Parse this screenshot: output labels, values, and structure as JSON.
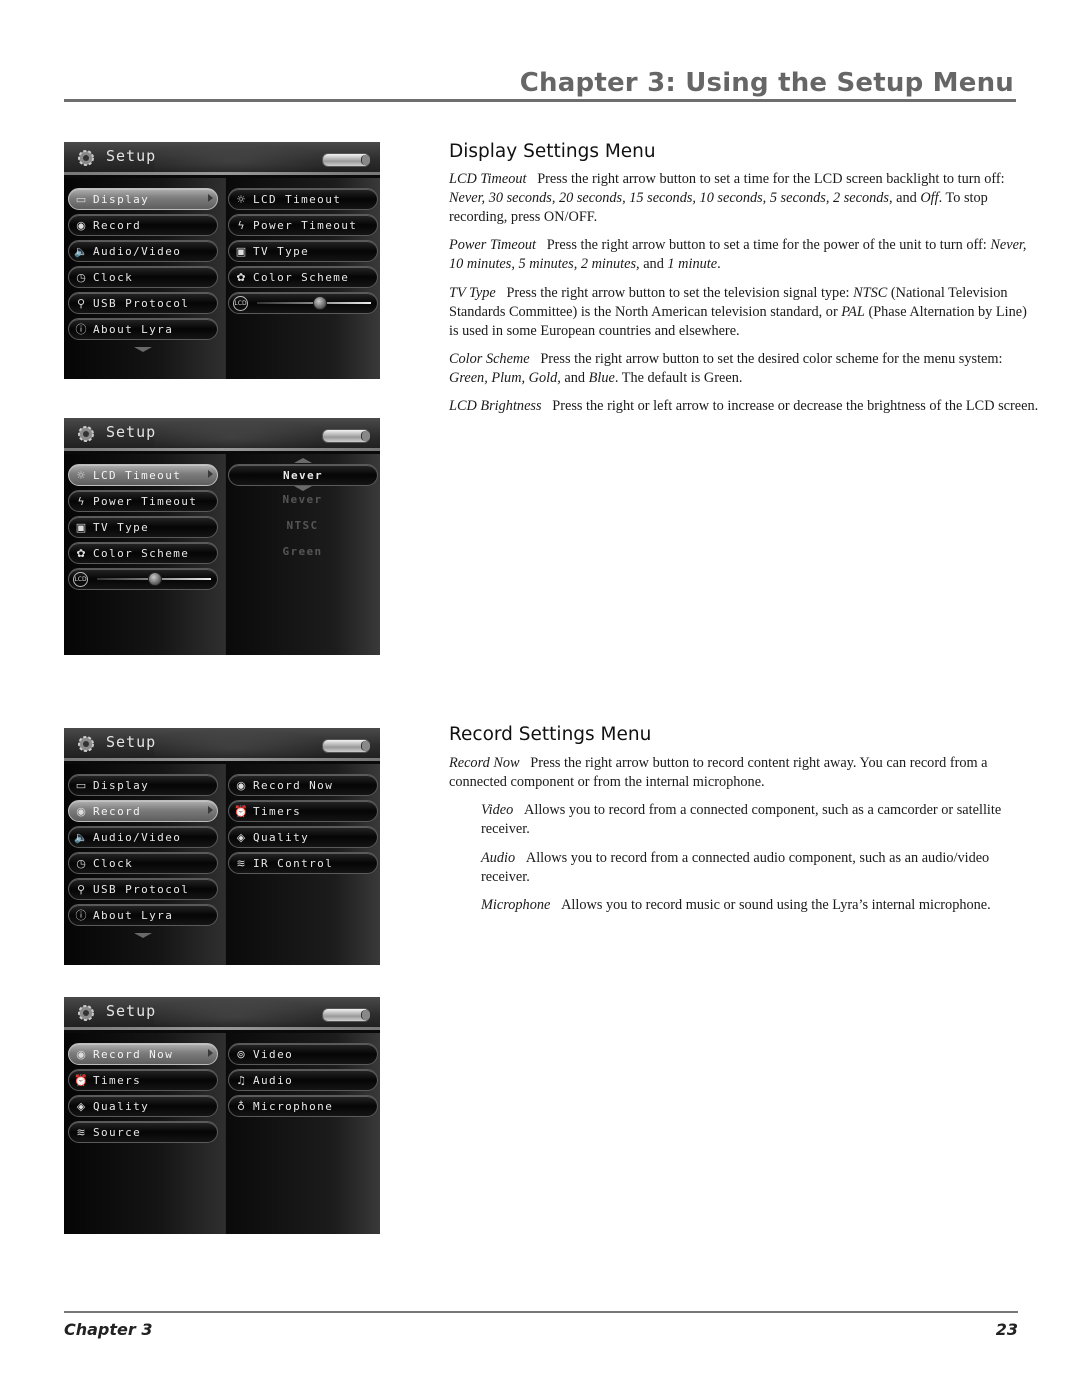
{
  "header": {
    "chapter_title": "Chapter 3: Using the Setup Menu"
  },
  "screens": [
    {
      "title": "Setup",
      "left_items": [
        {
          "label": "Display",
          "icon": "display-icon",
          "selected": true
        },
        {
          "label": "Record",
          "icon": "record-icon",
          "selected": false
        },
        {
          "label": "Audio/Video",
          "icon": "speaker-icon",
          "selected": false
        },
        {
          "label": "Clock",
          "icon": "clock-icon",
          "selected": false
        },
        {
          "label": "USB Protocol",
          "icon": "usb-icon",
          "selected": false
        },
        {
          "label": "About Lyra",
          "icon": "info-icon",
          "selected": false
        }
      ],
      "right_items": [
        {
          "label": "LCD Timeout",
          "icon": "lightbulb-icon"
        },
        {
          "label": "Power Timeout",
          "icon": "lightning-icon"
        },
        {
          "label": "TV Type",
          "icon": "tv-icon"
        },
        {
          "label": "Color Scheme",
          "icon": "palette-icon"
        }
      ],
      "brightness": {
        "icon_label": "LCD",
        "level": 0.55
      }
    },
    {
      "title": "Setup",
      "left_items": [
        {
          "label": "LCD Timeout",
          "icon": "lightbulb-icon",
          "selected": true
        },
        {
          "label": "Power Timeout",
          "icon": "lightning-icon",
          "selected": false
        },
        {
          "label": "TV Type",
          "icon": "tv-icon",
          "selected": false
        },
        {
          "label": "Color Scheme",
          "icon": "palette-icon",
          "selected": false
        }
      ],
      "brightness": {
        "icon_label": "LCD",
        "level": 0.5
      },
      "selected_value": "Never",
      "values": [
        "Never",
        "NTSC",
        "Green"
      ]
    },
    {
      "title": "Setup",
      "left_items": [
        {
          "label": "Display",
          "icon": "display-icon",
          "selected": false
        },
        {
          "label": "Record",
          "icon": "record-icon",
          "selected": true
        },
        {
          "label": "Audio/Video",
          "icon": "speaker-icon",
          "selected": false
        },
        {
          "label": "Clock",
          "icon": "clock-icon",
          "selected": false
        },
        {
          "label": "USB Protocol",
          "icon": "usb-icon",
          "selected": false
        },
        {
          "label": "About Lyra",
          "icon": "info-icon",
          "selected": false
        }
      ],
      "right_items": [
        {
          "label": "Record Now",
          "icon": "record-icon"
        },
        {
          "label": "Timers",
          "icon": "alarm-clock-icon"
        },
        {
          "label": "Quality",
          "icon": "diamond-icon"
        },
        {
          "label": "IR Control",
          "icon": "wireless-icon"
        }
      ]
    },
    {
      "title": "Setup",
      "left_items": [
        {
          "label": "Record Now",
          "icon": "record-icon",
          "selected": true
        },
        {
          "label": "Timers",
          "icon": "alarm-clock-icon",
          "selected": false
        },
        {
          "label": "Quality",
          "icon": "diamond-icon",
          "selected": false
        },
        {
          "label": "Source",
          "icon": "wireless-icon",
          "selected": false
        }
      ],
      "right_items": [
        {
          "label": "Video",
          "icon": "camera-icon"
        },
        {
          "label": "Audio",
          "icon": "music-note-icon"
        },
        {
          "label": "Microphone",
          "icon": "microphone-icon"
        }
      ]
    }
  ],
  "display_section": {
    "title": "Display Settings Menu",
    "paragraphs": [
      {
        "term": "LCD Timeout",
        "html": "Press the right arrow button to set a time for the LCD screen backlight to turn off: <i>Never, 30 seconds, 20 seconds, 15 seconds, 10 seconds, 5 seconds, 2 seconds,</i> and <i>Off</i>. To stop recording, press ON/OFF."
      },
      {
        "term": "Power Timeout",
        "html": "Press the right arrow button to set a time for the power of the unit to turn off: <i>Never, 10 minutes, 5 minutes, 2 minutes,</i> and <i>1 minute</i>."
      },
      {
        "term": "TV Type",
        "html": "Press the right arrow button to set the television signal type: <i>NTSC</i> (National Television Standards Committee) is the North American television standard, or <i>PAL</i> (Phase Alternation by Line) is used in some European countries and elsewhere."
      },
      {
        "term": "Color Scheme",
        "html": "Press the right arrow button to set the desired color scheme for the menu system: <i>Green, Plum, Gold,</i> and <i>Blue</i>. The default is Green."
      },
      {
        "term": "LCD Brightness",
        "html": "Press the right or left arrow to increase or decrease the brightness of the LCD screen."
      }
    ]
  },
  "record_section": {
    "title": "Record Settings Menu",
    "paragraphs": [
      {
        "term": "Record Now",
        "html": "Press the right arrow button to record content right away. You can record from a connected component or from the internal microphone.",
        "indent": false
      },
      {
        "term": "Video",
        "html": "Allows you to record from a connected component, such as a camcorder or satellite receiver.",
        "indent": true
      },
      {
        "term": "Audio",
        "html": "Allows you to record from a connected audio component, such as an audio/video receiver.",
        "indent": true
      },
      {
        "term": "Microphone",
        "html": "Allows you to record music or sound using the Lyra’s internal microphone.",
        "indent": true
      }
    ]
  },
  "footer": {
    "chapter_label": "Chapter 3",
    "page_number": "23"
  }
}
